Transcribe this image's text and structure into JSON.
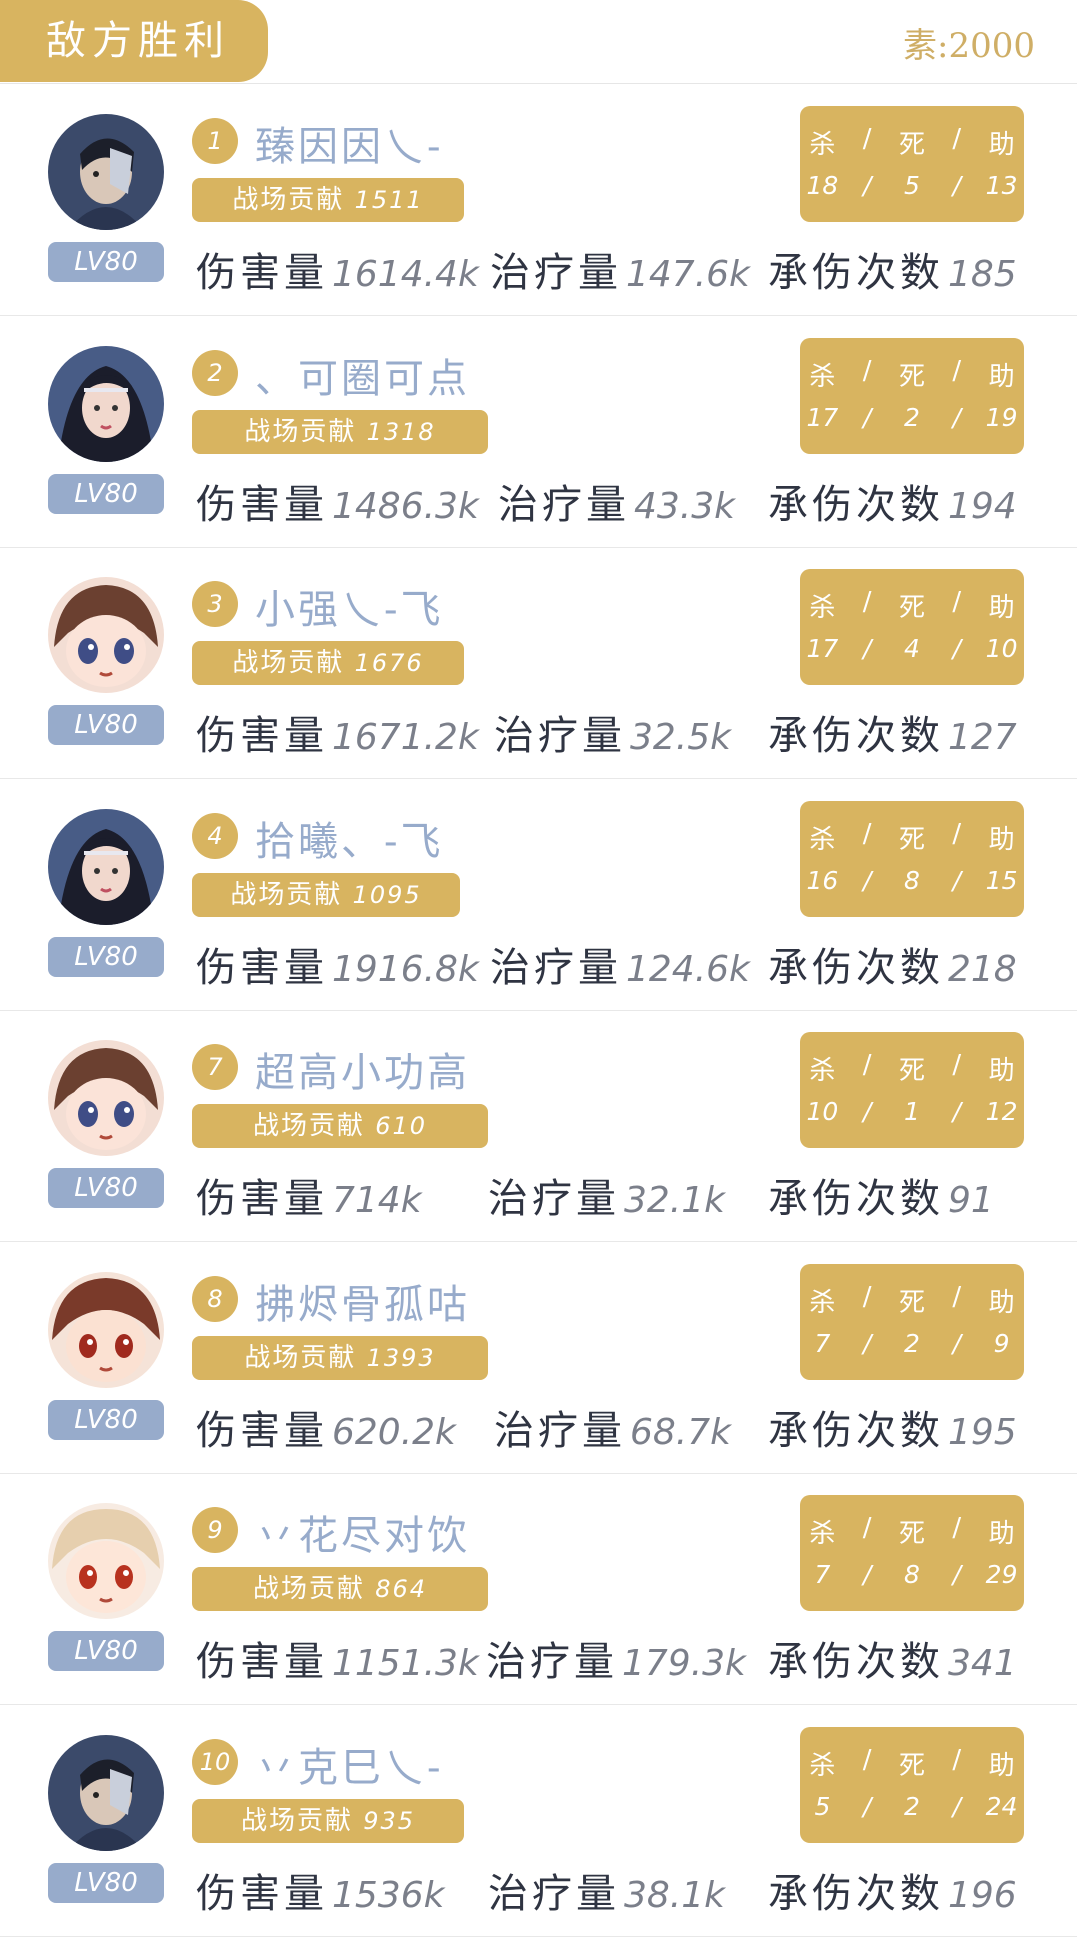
{
  "header": {
    "result": "敌方胜利",
    "score_text": "素:2000"
  },
  "labels": {
    "contribution": "战场贡献",
    "kda": [
      "杀",
      "死",
      "助"
    ],
    "damage": "伤害量",
    "heal": "治疗量",
    "hits": "承伤次数"
  },
  "colors": {
    "gold": "#d8b460",
    "blue_gray": "#97abcb",
    "text_dark": "#2f3442",
    "text_gray": "#7b7f8a"
  },
  "players": [
    {
      "rank": "1",
      "name": "臻因因乀-",
      "level": "LV80",
      "contribution": "1511",
      "kills": "18",
      "deaths": "5",
      "assists": "13",
      "damage": "1614.4k",
      "heal": "147.6k",
      "hits": "185",
      "avatar": "avatar-male-silver-mask"
    },
    {
      "rank": "2",
      "name": "、可圈可点",
      "level": "LV80",
      "contribution": "1318",
      "kills": "17",
      "deaths": "2",
      "assists": "19",
      "damage": "1486.3k",
      "heal": "43.3k",
      "hits": "194",
      "avatar": "avatar-female-dark-hair"
    },
    {
      "rank": "3",
      "name": "小强乀-飞",
      "level": "LV80",
      "contribution": "1676",
      "kills": "17",
      "deaths": "4",
      "assists": "10",
      "damage": "1671.2k",
      "heal": "32.5k",
      "hits": "127",
      "avatar": "avatar-chibi-brown"
    },
    {
      "rank": "4",
      "name": "拾曦、-飞",
      "level": "LV80",
      "contribution": "1095",
      "kills": "16",
      "deaths": "8",
      "assists": "15",
      "damage": "1916.8k",
      "heal": "124.6k",
      "hits": "218",
      "avatar": "avatar-female-dark-hair"
    },
    {
      "rank": "7",
      "name": "超高小功高",
      "level": "LV80",
      "contribution": "610",
      "kills": "10",
      "deaths": "1",
      "assists": "12",
      "damage": "714k",
      "heal": "32.1k",
      "hits": "91",
      "avatar": "avatar-chibi-brown"
    },
    {
      "rank": "8",
      "name": "拂烬骨孤咕",
      "level": "LV80",
      "contribution": "1393",
      "kills": "7",
      "deaths": "2",
      "assists": "9",
      "damage": "620.2k",
      "heal": "68.7k",
      "hits": "195",
      "avatar": "avatar-chibi-red"
    },
    {
      "rank": "9",
      "name": "丷花尽对饮",
      "level": "LV80",
      "contribution": "864",
      "kills": "7",
      "deaths": "8",
      "assists": "29",
      "damage": "1151.3k",
      "heal": "179.3k",
      "hits": "341",
      "avatar": "avatar-chibi-blonde"
    },
    {
      "rank": "10",
      "name": "丷克巳乀-",
      "level": "LV80",
      "contribution": "935",
      "kills": "5",
      "deaths": "2",
      "assists": "24",
      "damage": "1536k",
      "heal": "38.1k",
      "hits": "196",
      "avatar": "avatar-male-silver-mask"
    }
  ]
}
